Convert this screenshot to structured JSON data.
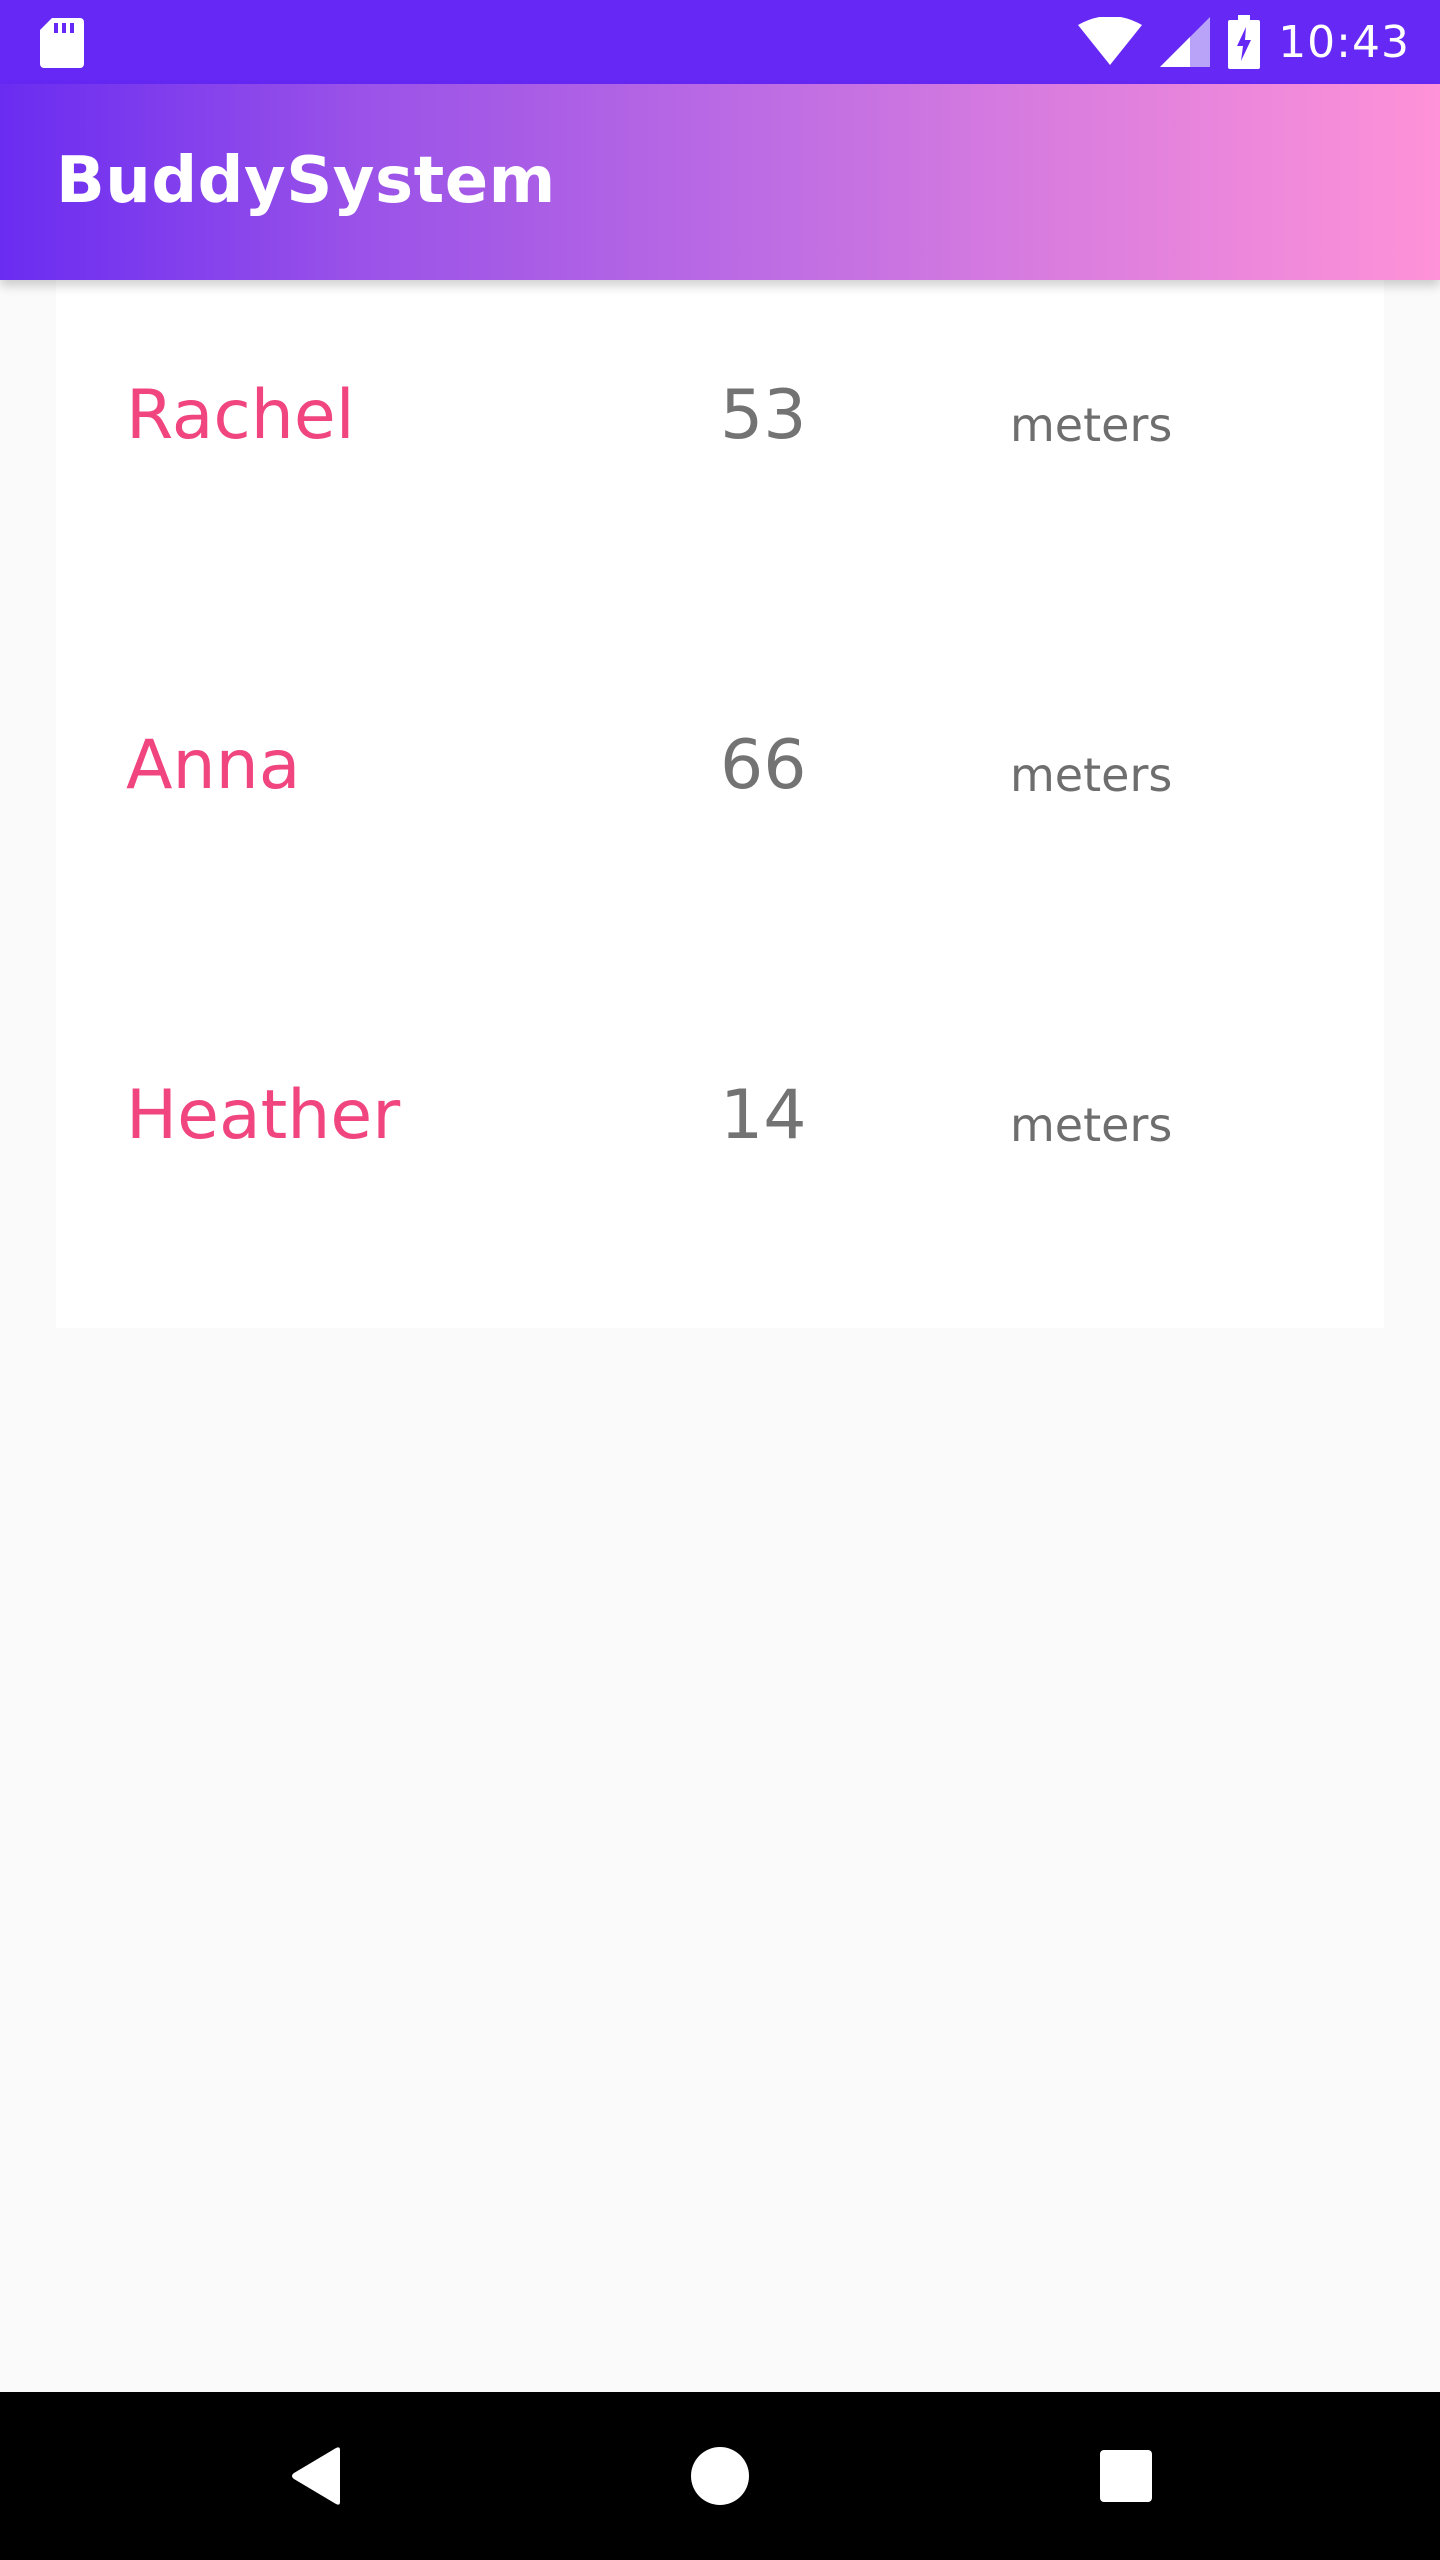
{
  "status_bar": {
    "time": "10:43",
    "icons": [
      "sd-card-icon",
      "wifi-icon",
      "signal-icon",
      "battery-charging-icon"
    ]
  },
  "app_bar": {
    "title": "BuddySystem"
  },
  "buddies": [
    {
      "name": "Rachel",
      "distance": "53",
      "unit": "meters"
    },
    {
      "name": "Anna",
      "distance": "66",
      "unit": "meters"
    },
    {
      "name": "Heather",
      "distance": "14",
      "unit": "meters"
    }
  ],
  "nav_bar": {
    "buttons": [
      "back-icon",
      "home-icon",
      "recents-icon"
    ]
  },
  "colors": {
    "status_bar": "#6528f5",
    "gradient_start": "#6a2cf1",
    "gradient_end": "#ff92d8",
    "name_color": "#f0457f",
    "distance_color": "#737373"
  }
}
